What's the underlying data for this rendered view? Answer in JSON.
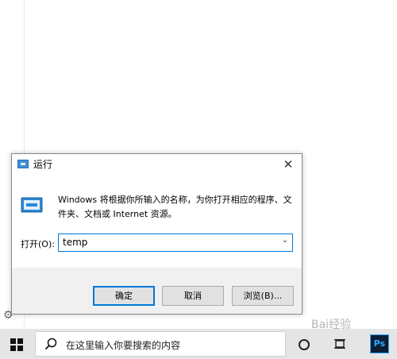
{
  "run_dialog": {
    "title": "运行",
    "close_glyph": "✕",
    "description": "Windows 将根据你所输入的名称，为你打开相应的程序、文件夹、文档或 Internet 资源。",
    "open_label": "打开(O):",
    "input_value": "temp",
    "ok_label": "确定",
    "cancel_label": "取消",
    "browse_label": "浏览(B)..."
  },
  "taskbar": {
    "search_placeholder": "在这里输入你要搜索的内容",
    "ps_label": "Ps"
  },
  "watermark": "Bai经验",
  "colors": {
    "accent": "#0078d7",
    "taskbar_bg": "#e5e5e5",
    "dialog_bg": "#f0f0f0"
  },
  "icons": [
    "run-app-icon",
    "close-icon",
    "chevron-down-icon",
    "windows-start-icon",
    "search-icon",
    "cortana-icon",
    "task-view-icon",
    "photoshop-icon",
    "gear-icon"
  ]
}
